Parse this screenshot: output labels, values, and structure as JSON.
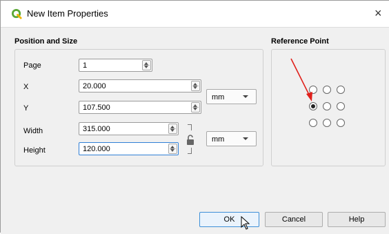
{
  "window": {
    "title": "New Item Properties",
    "close_symbol": "×",
    "app_icon": "qgis-logo-icon"
  },
  "position_size": {
    "group_title": "Position and Size",
    "page_label": "Page",
    "page_value": "1",
    "x_label": "X",
    "x_value": "20.000",
    "y_label": "Y",
    "y_value": "107.500",
    "position_unit": "mm",
    "width_label": "Width",
    "width_value": "315.000",
    "height_label": "Height",
    "height_value": "120.000",
    "size_unit": "mm",
    "lock_icon": "padlock-open-icon"
  },
  "reference_point": {
    "group_title": "Reference Point",
    "selected_index": 3,
    "annotation_color": "#e0201b"
  },
  "buttons": {
    "ok": "OK",
    "cancel": "Cancel",
    "help": "Help"
  }
}
